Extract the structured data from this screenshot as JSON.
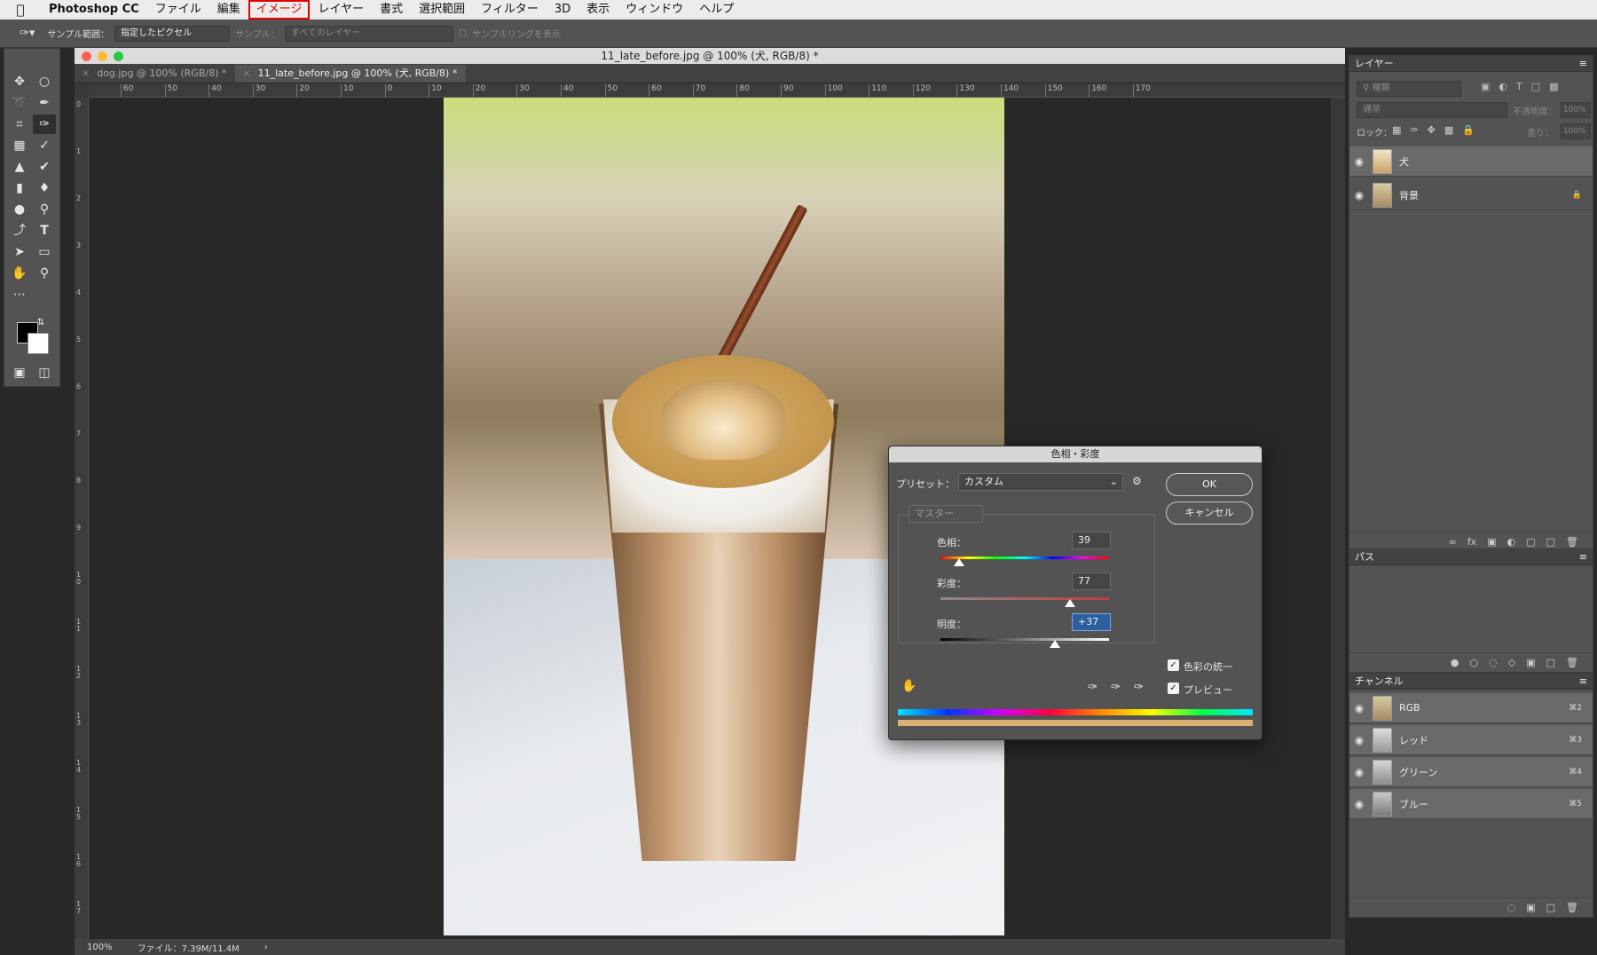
{
  "menubar": {
    "app": "Photoshop CC",
    "items": [
      "ファイル",
      "編集",
      "イメージ",
      "レイヤー",
      "書式",
      "選択範囲",
      "フィルター",
      "3D",
      "表示",
      "ウィンドウ",
      "ヘルプ"
    ],
    "highlighted": "イメージ"
  },
  "options": {
    "sample_area_label": "サンプル範囲：",
    "sample_area_value": "指定したピクセル",
    "sample_label": "サンプル：",
    "sample_value": "すべてのレイヤー",
    "ring_label": "サンプルリングを表示"
  },
  "document": {
    "title": "11_late_before.jpg @ 100% (犬, RGB/8) *",
    "tabs": [
      {
        "label": "dog.jpg @ 100% (RGB/8) *",
        "active": false
      },
      {
        "label": "11_late_before.jpg @ 100% (犬, RGB/8) *",
        "active": true
      }
    ],
    "ruler_h": [
      "60",
      "50",
      "40",
      "30",
      "20",
      "10",
      "0",
      "10",
      "20",
      "30",
      "40",
      "50",
      "60",
      "70",
      "80",
      "90",
      "100",
      "110",
      "120",
      "130",
      "140",
      "150",
      "160",
      "170"
    ],
    "ruler_v": [
      "0",
      "1",
      "2",
      "3",
      "4",
      "5",
      "6",
      "7",
      "8",
      "9",
      "1 0",
      "1 1",
      "1 2",
      "1 3",
      "1 4",
      "1 5",
      "1 6",
      "1 7"
    ]
  },
  "status": {
    "zoom": "100%",
    "file": "ファイル：7.39M/11.4M",
    "arrow": "›"
  },
  "dialog": {
    "title": "色相・彩度",
    "preset_label": "プリセット：",
    "preset_value": "カスタム",
    "ok": "OK",
    "cancel": "キャンセル",
    "channel": "マスター",
    "hue_label": "色相：",
    "hue_value": "39",
    "saturation_label": "彩度：",
    "saturation_value": "77",
    "lightness_label": "明度：",
    "lightness_value": "+37",
    "colorize_label": "色彩の統一",
    "colorize_checked": true,
    "preview_label": "プレビュー",
    "preview_checked": true,
    "hue_pos": 0.11,
    "saturation_pos": 0.77,
    "lightness_pos": 0.68
  },
  "layers_panel": {
    "title": "レイヤー",
    "search_placeholder": "種類",
    "blend_mode": "通常",
    "opacity_label": "不透明度：",
    "opacity_value": "100%",
    "lock_label": "ロック：",
    "fill_label": "塗り：",
    "fill_value": "100%",
    "layers": [
      {
        "name": "犬",
        "selected": true
      },
      {
        "name": "背景",
        "selected": false
      }
    ]
  },
  "paths_panel": {
    "title": "パス"
  },
  "channels_panel": {
    "title": "チャンネル",
    "channels": [
      {
        "name": "RGB",
        "shortcut": "⌘2"
      },
      {
        "name": "レッド",
        "shortcut": "⌘3"
      },
      {
        "name": "グリーン",
        "shortcut": "⌘4"
      },
      {
        "name": "ブルー",
        "shortcut": "⌘5"
      }
    ]
  }
}
